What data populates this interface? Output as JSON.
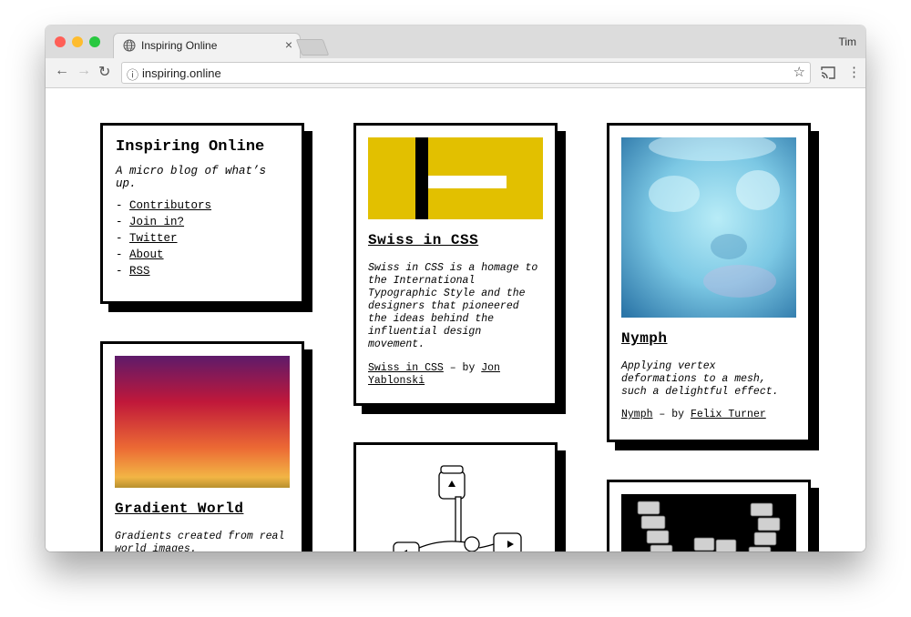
{
  "browser": {
    "tab_title": "Inspiring Online",
    "tab_close": "×",
    "profile": "Tim",
    "url": "inspiring.online",
    "back": "←",
    "forward": "→",
    "reload": "↻",
    "info_icon": "ⓘ",
    "star": "☆",
    "cast_icon": "cast-icon",
    "menu": "⋮",
    "traffic_colors": [
      "#ff5f57",
      "#febc2e",
      "#28c840"
    ]
  },
  "site": {
    "title": "Inspiring Online",
    "tagline": "A micro blog of what’s up.",
    "nav_dash": "-",
    "nav": [
      "Contributors",
      "Join in?",
      "Twitter",
      "About",
      "RSS"
    ]
  },
  "posts": [
    {
      "title": "Swiss in CSS",
      "description": "Swiss in CSS is a homage to the International Typographic Style and the designers that pioneered the ideas behind the influential design movement.",
      "link_text": "Swiss in CSS",
      "by": "– by",
      "author": "Jon Yablonski",
      "accent": "#e2c000"
    },
    {
      "title": "Nymph",
      "description": "Applying vertex deformations to a mesh, such a delightful effect.",
      "link_text": "Nymph",
      "by": "– by",
      "author": "Felix Turner"
    },
    {
      "title": "Gradient World",
      "description": "Gradients created from real world images."
    }
  ]
}
